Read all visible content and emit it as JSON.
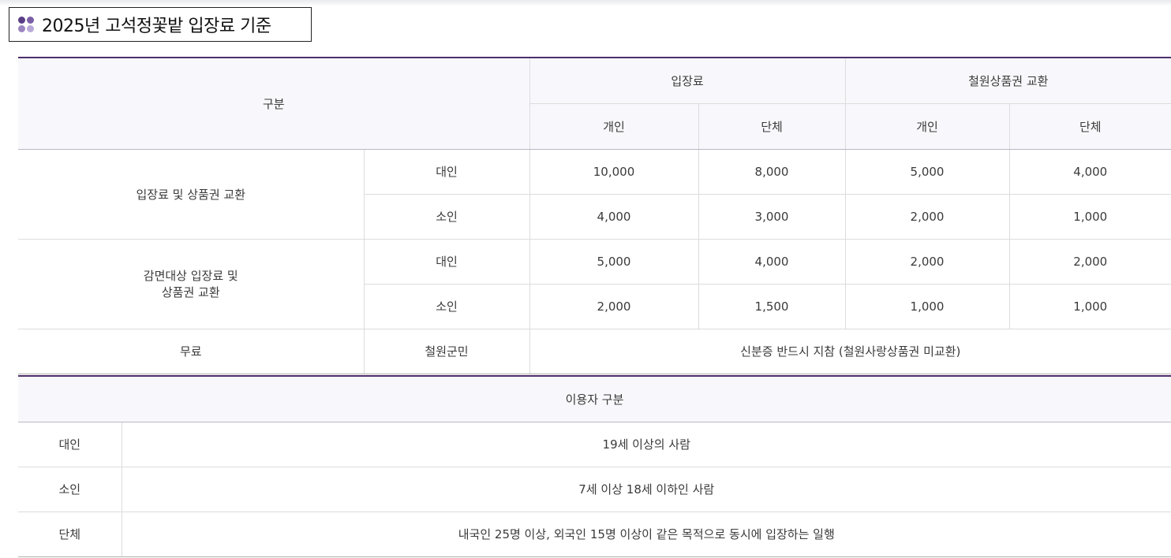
{
  "title": "2025년 고석정꽃밭 입장료 기준",
  "icon": "four-dots-icon",
  "fee_table": {
    "header": {
      "category": "구분",
      "admission": "입장료",
      "voucher": "철원상품권 교환",
      "individual": "개인",
      "group": "단체"
    },
    "sections": [
      {
        "label": "입장료 및 상품권 교환",
        "rows": [
          {
            "type": "대인",
            "admission_individual": "10,000",
            "admission_group": "8,000",
            "voucher_individual": "5,000",
            "voucher_group": "4,000"
          },
          {
            "type": "소인",
            "admission_individual": "4,000",
            "admission_group": "3,000",
            "voucher_individual": "2,000",
            "voucher_group": "1,000"
          }
        ]
      },
      {
        "label_line1": "감면대상 입장료 및",
        "label_line2": "상품권 교환",
        "rows": [
          {
            "type": "대인",
            "admission_individual": "5,000",
            "admission_group": "4,000",
            "voucher_individual": "2,000",
            "voucher_group": "2,000"
          },
          {
            "type": "소인",
            "admission_individual": "2,000",
            "admission_group": "1,500",
            "voucher_individual": "1,000",
            "voucher_group": "1,000"
          }
        ]
      }
    ],
    "free": {
      "label": "무료",
      "type": "철원군민",
      "note": "신분증 반드시 지참 (철원사랑상품권 미교환)"
    }
  },
  "user_table": {
    "header": "이용자 구분",
    "rows": [
      {
        "type": "대인",
        "description": "19세 이상의 사람"
      },
      {
        "type": "소인",
        "description": "7세 이상 18세 이하인 사람"
      },
      {
        "type": "단체",
        "description": "내국인 25명 이상, 외국인 15명 이상이 같은 목적으로 동시에 입장하는 일행"
      }
    ]
  },
  "colors": {
    "accent": "#4d2f6b",
    "header_bg": "#f8f8fc"
  }
}
